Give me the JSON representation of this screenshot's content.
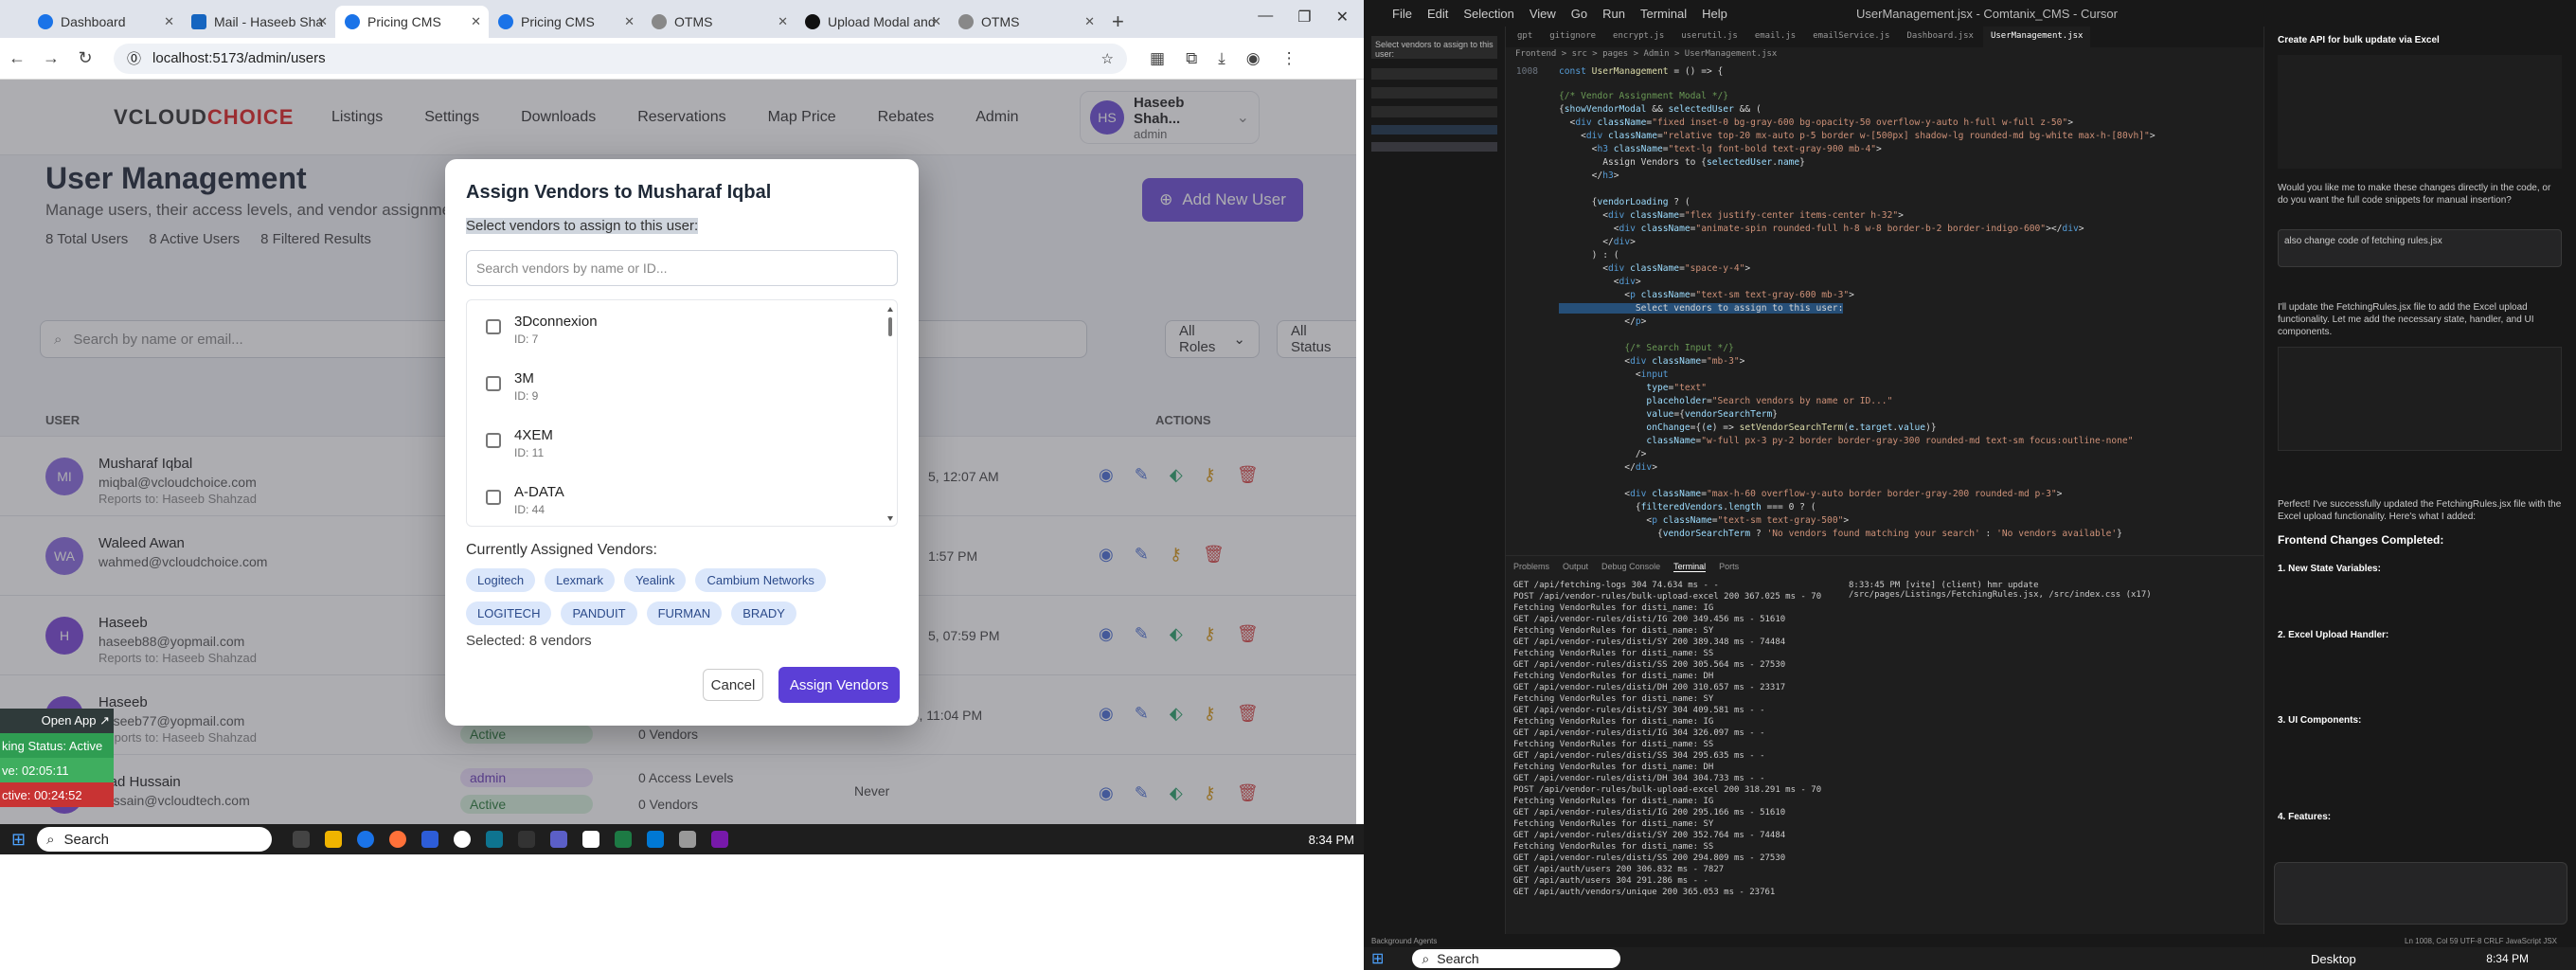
{
  "browser": {
    "tabs": [
      {
        "label": "Dashboard",
        "active": false
      },
      {
        "label": "Mail - Haseeb Sha",
        "active": false
      },
      {
        "label": "Pricing CMS",
        "active": true
      },
      {
        "label": "Pricing CMS",
        "active": false
      },
      {
        "label": "OTMS",
        "active": false
      },
      {
        "label": "Upload Modal and",
        "active": false
      },
      {
        "label": "OTMS",
        "active": false
      }
    ],
    "url": "localhost:5173/admin/users"
  },
  "app": {
    "logo_main": "VCLOUD",
    "logo_accent": "CHOICE",
    "menu": [
      "Listings",
      "Settings",
      "Downloads",
      "Reservations",
      "Map Price",
      "Rebates",
      "Admin"
    ],
    "user": {
      "initials": "HS",
      "name": "Haseeb Shah...",
      "role": "admin"
    },
    "title": "User Management",
    "subtitle": "Manage users, their access levels, and vendor assignments",
    "stats": [
      "8 Total Users",
      "8 Active Users",
      "8 Filtered Results"
    ],
    "add_button": "Add New User",
    "search_placeholder": "Search by name or email...",
    "roles_filter": "All Roles",
    "status_filter": "All Status",
    "columns": {
      "user": "USER",
      "actions": "ACTIONS"
    },
    "rows": [
      {
        "initials": "MI",
        "name": "Musharaf Iqbal",
        "email": "miqbal@vcloudchoice.com",
        "reports": "Reports to: Haseeb Shahzad",
        "time": "5, 12:07 AM"
      },
      {
        "initials": "WA",
        "name": "Waleed Awan",
        "email": "wahmed@vcloudchoice.com",
        "reports": "",
        "time": "1:57 PM"
      },
      {
        "initials": "H",
        "name": "Haseeb",
        "email": "haseeb88@yopmail.com",
        "reports": "Reports to: Haseeb Shahzad",
        "time": "5, 07:59 PM"
      },
      {
        "initials": "H",
        "name": "Haseeb",
        "email": "haseeb77@yopmail.com",
        "reports": "Reports to: Haseeb Shahzad",
        "status": "Active",
        "vendors": "0 Vendors",
        "time": "Jul 1, 2025, 11:04 PM"
      },
      {
        "initials": "SH",
        "name": "ajad Hussain",
        "email": "hussain@vcloudtech.com",
        "reports": "",
        "role": "admin",
        "status": "Active",
        "access": "0 Access Levels",
        "vendors": "0 Vendors",
        "time": "Never"
      }
    ]
  },
  "modal": {
    "title": "Assign Vendors to Musharaf Iqbal",
    "instruction": "Select vendors to assign to this user:",
    "search_placeholder": "Search vendors by name or ID...",
    "vendors": [
      {
        "name": "3Dconnexion",
        "id": "ID: 7"
      },
      {
        "name": "3M",
        "id": "ID: 9"
      },
      {
        "name": "4XEM",
        "id": "ID: 11"
      },
      {
        "name": "A-DATA",
        "id": "ID: 44"
      }
    ],
    "current_label": "Currently Assigned Vendors:",
    "assigned": [
      "Logitech",
      "Lexmark",
      "Yealink",
      "Cambium Networks",
      "LOGITECH",
      "PANDUIT",
      "FURMAN",
      "BRADY"
    ],
    "selected_count": "Selected: 8 vendors",
    "cancel": "Cancel",
    "assign": "Assign Vendors"
  },
  "overlay_widget": {
    "open_app": "Open App ↗",
    "status": "king Status: Active",
    "active_time": "ve: 02:05:11",
    "inactive_time": "ctive: 00:24:52"
  },
  "taskbar": {
    "search": "Search",
    "time": "8:34 PM"
  },
  "ide": {
    "menu": [
      "File",
      "Edit",
      "Selection",
      "View",
      "Go",
      "Run",
      "Terminal",
      "Help"
    ],
    "title": "UserManagement.jsx - Comtanix_CMS - Cursor",
    "tabs": [
      "UserManagement.jsx"
    ],
    "breadcrumb": "Frontend > src > pages > Admin > UserManagement.jsx",
    "search_box": "Select vendors to assign to this user:",
    "first_line": "1008",
    "terminal_tabs": [
      "Problems",
      "Output",
      "Debug Console",
      "Terminal",
      "Ports"
    ],
    "terminal_right": "8:33:45 PM [vite] (client) hmr update /src/pages/Listings/FetchingRules.jsx, /src/index.css (x17)",
    "chat_title": "Create API for bulk update via Excel",
    "chat_question": "Would you like me to make these changes directly in the code, or do you want the full code snippets for manual insertion?",
    "chat_request": "also change code of fetching rules.jsx",
    "chat_reply": "I'll update the FetchingRules.jsx file to add the Excel upload functionality. Let me add the necessary state, handler, and UI components.",
    "chat_done": "Perfect! I've successfully updated the FetchingRules.jsx file with the Excel upload functionality. Here's what I added:",
    "chat_heading": "Frontend Changes Completed:",
    "chat_points": [
      "1. New State Variables:",
      "2. Excel Upload Handler:",
      "3. UI Components:",
      "4. Features:"
    ],
    "status_left": "Background Agents",
    "status_right": "Ln 1008, Col 59  UTF-8  CRLF  JavaScript JSX",
    "taskbar_search": "Search",
    "taskbar_desktop": "Desktop",
    "taskbar_time": "8:34 PM"
  }
}
